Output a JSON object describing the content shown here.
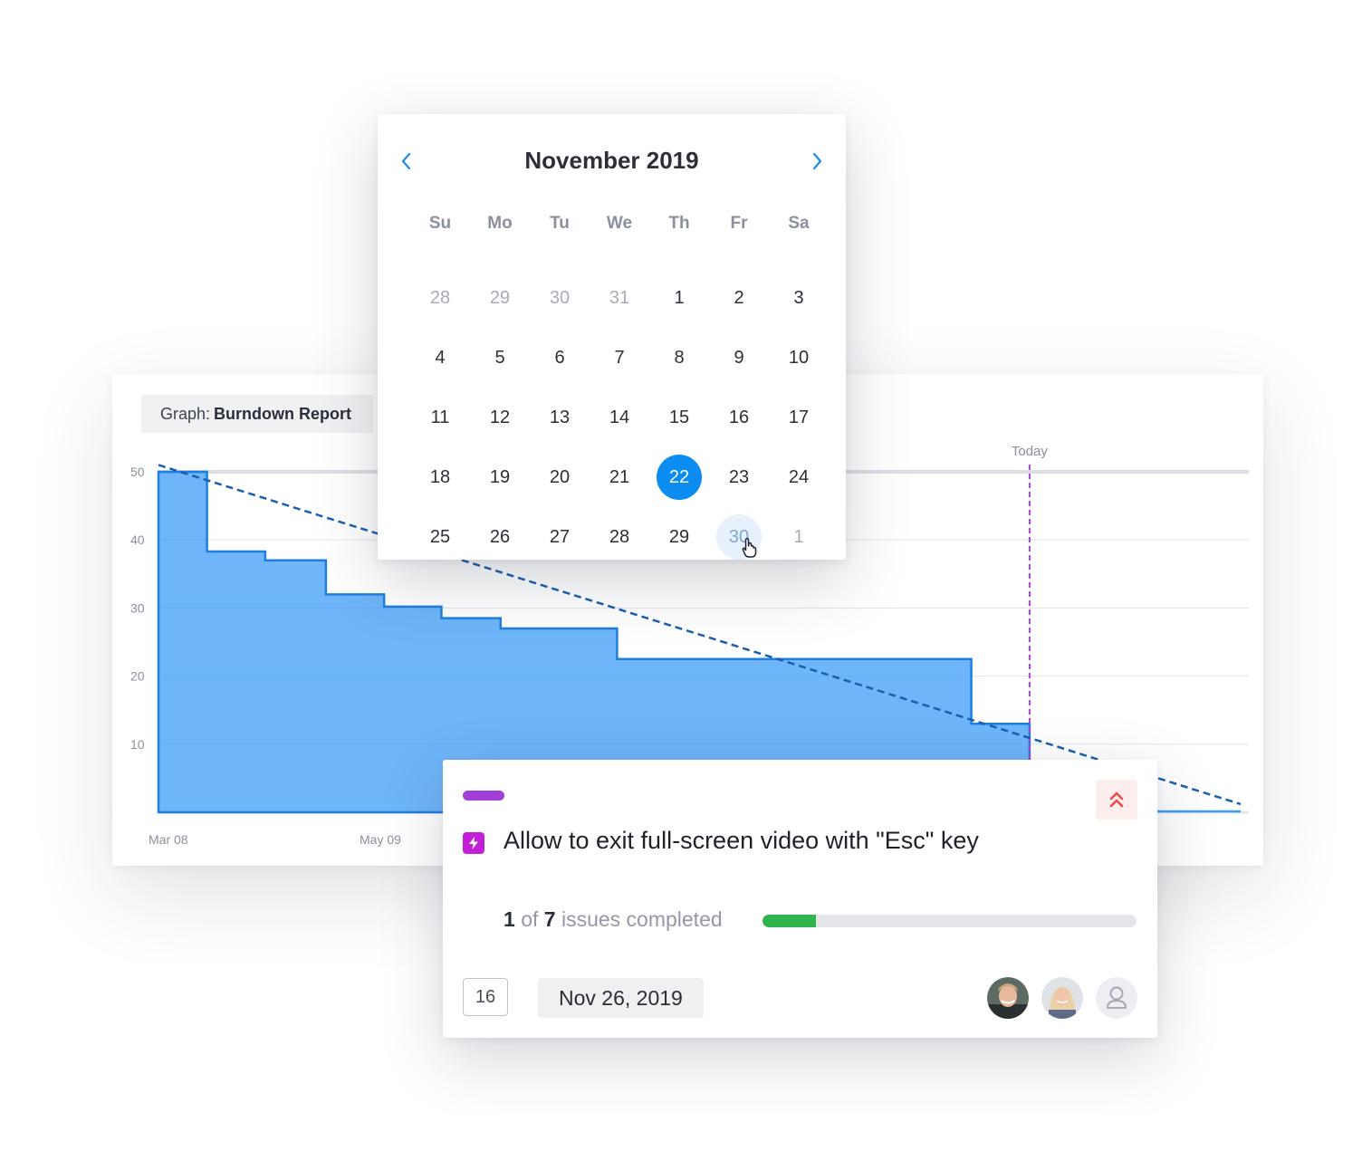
{
  "graph": {
    "label_prefix": "Graph:",
    "label_name": "Burndown Report"
  },
  "chart_data": {
    "type": "area",
    "title": "",
    "xlabel": "",
    "ylabel": "",
    "ylim": [
      0,
      50
    ],
    "y_ticks": [
      "10",
      "20",
      "30",
      "40",
      "50"
    ],
    "x_tick_labels": [
      "Mar 08",
      "May 09"
    ],
    "today_label": "Today",
    "grid": true,
    "series": [
      {
        "name": "",
        "step": true,
        "points": [
          [
            0,
            50
          ],
          [
            1.0,
            38.3
          ],
          [
            2.2,
            37
          ],
          [
            3.45,
            32
          ],
          [
            4.65,
            30.2
          ],
          [
            5.83,
            28.5
          ],
          [
            7.05,
            27
          ],
          [
            9.45,
            22.5
          ],
          [
            16.75,
            13
          ],
          [
            17.95,
            0
          ]
        ],
        "color": "#3d9cf7"
      },
      {
        "name": "",
        "style": "dashed",
        "points": [
          [
            0,
            51
          ],
          [
            22.3,
            1.2
          ]
        ],
        "color": "#1a5fb0"
      }
    ],
    "today_x": 17.95,
    "x_max": 22.3,
    "today_color": "#b03fd6"
  },
  "calendar": {
    "month_label": "November 2019",
    "prev_label": "Previous month",
    "next_label": "Next month",
    "weekdays": [
      "Su",
      "Mo",
      "Tu",
      "We",
      "Th",
      "Fr",
      "Sa"
    ],
    "days": [
      [
        "28",
        "29",
        "30",
        "31",
        "1",
        "2",
        "3"
      ],
      [
        "4",
        "5",
        "6",
        "7",
        "8",
        "9",
        "10"
      ],
      [
        "11",
        "12",
        "13",
        "14",
        "15",
        "16",
        "17"
      ],
      [
        "18",
        "19",
        "20",
        "21",
        "22",
        "23",
        "24"
      ],
      [
        "25",
        "26",
        "27",
        "28",
        "29",
        "30",
        "1"
      ]
    ],
    "selected": "22",
    "hovered": "30",
    "accent": "#0a8cf0"
  },
  "issue": {
    "label_color": "#a23fd6",
    "type_icon": "lightning-icon",
    "priority_icon": "double-chevron-up-icon",
    "title": "Allow to exit full-screen video with \"Esc\" key",
    "progress": {
      "done": "1",
      "of": "of",
      "total": "7",
      "suffix": "issues completed",
      "fraction": 0.143
    },
    "estimate": "16",
    "due_date": "Nov 26, 2019",
    "assignees": [
      "avatar-1",
      "avatar-2",
      "unassigned-user-icon"
    ]
  }
}
